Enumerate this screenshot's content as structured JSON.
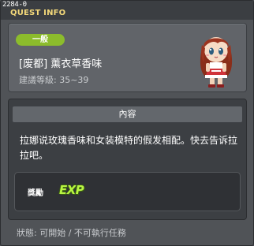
{
  "window": {
    "id": "2284-0",
    "title": "QUEST INFO"
  },
  "quest": {
    "category_badge": "一般",
    "name": "[废都] 薰衣草香味",
    "recommended_level": "建議等級: 35~39",
    "npc_icon": "npc-girl-portrait-icon"
  },
  "content": {
    "header": "內容",
    "description": "拉娜说玫瑰香味和女装模特的假发相配。快去告诉拉拉吧。"
  },
  "reward": {
    "label": "獎勵",
    "exp_label": "EXP"
  },
  "status": {
    "text": "狀態: 可開始 / 不可執行任務"
  },
  "colors": {
    "badge": "#8cbc2c",
    "title_text": "#f4d97a",
    "exp_text": "#b8f542"
  }
}
